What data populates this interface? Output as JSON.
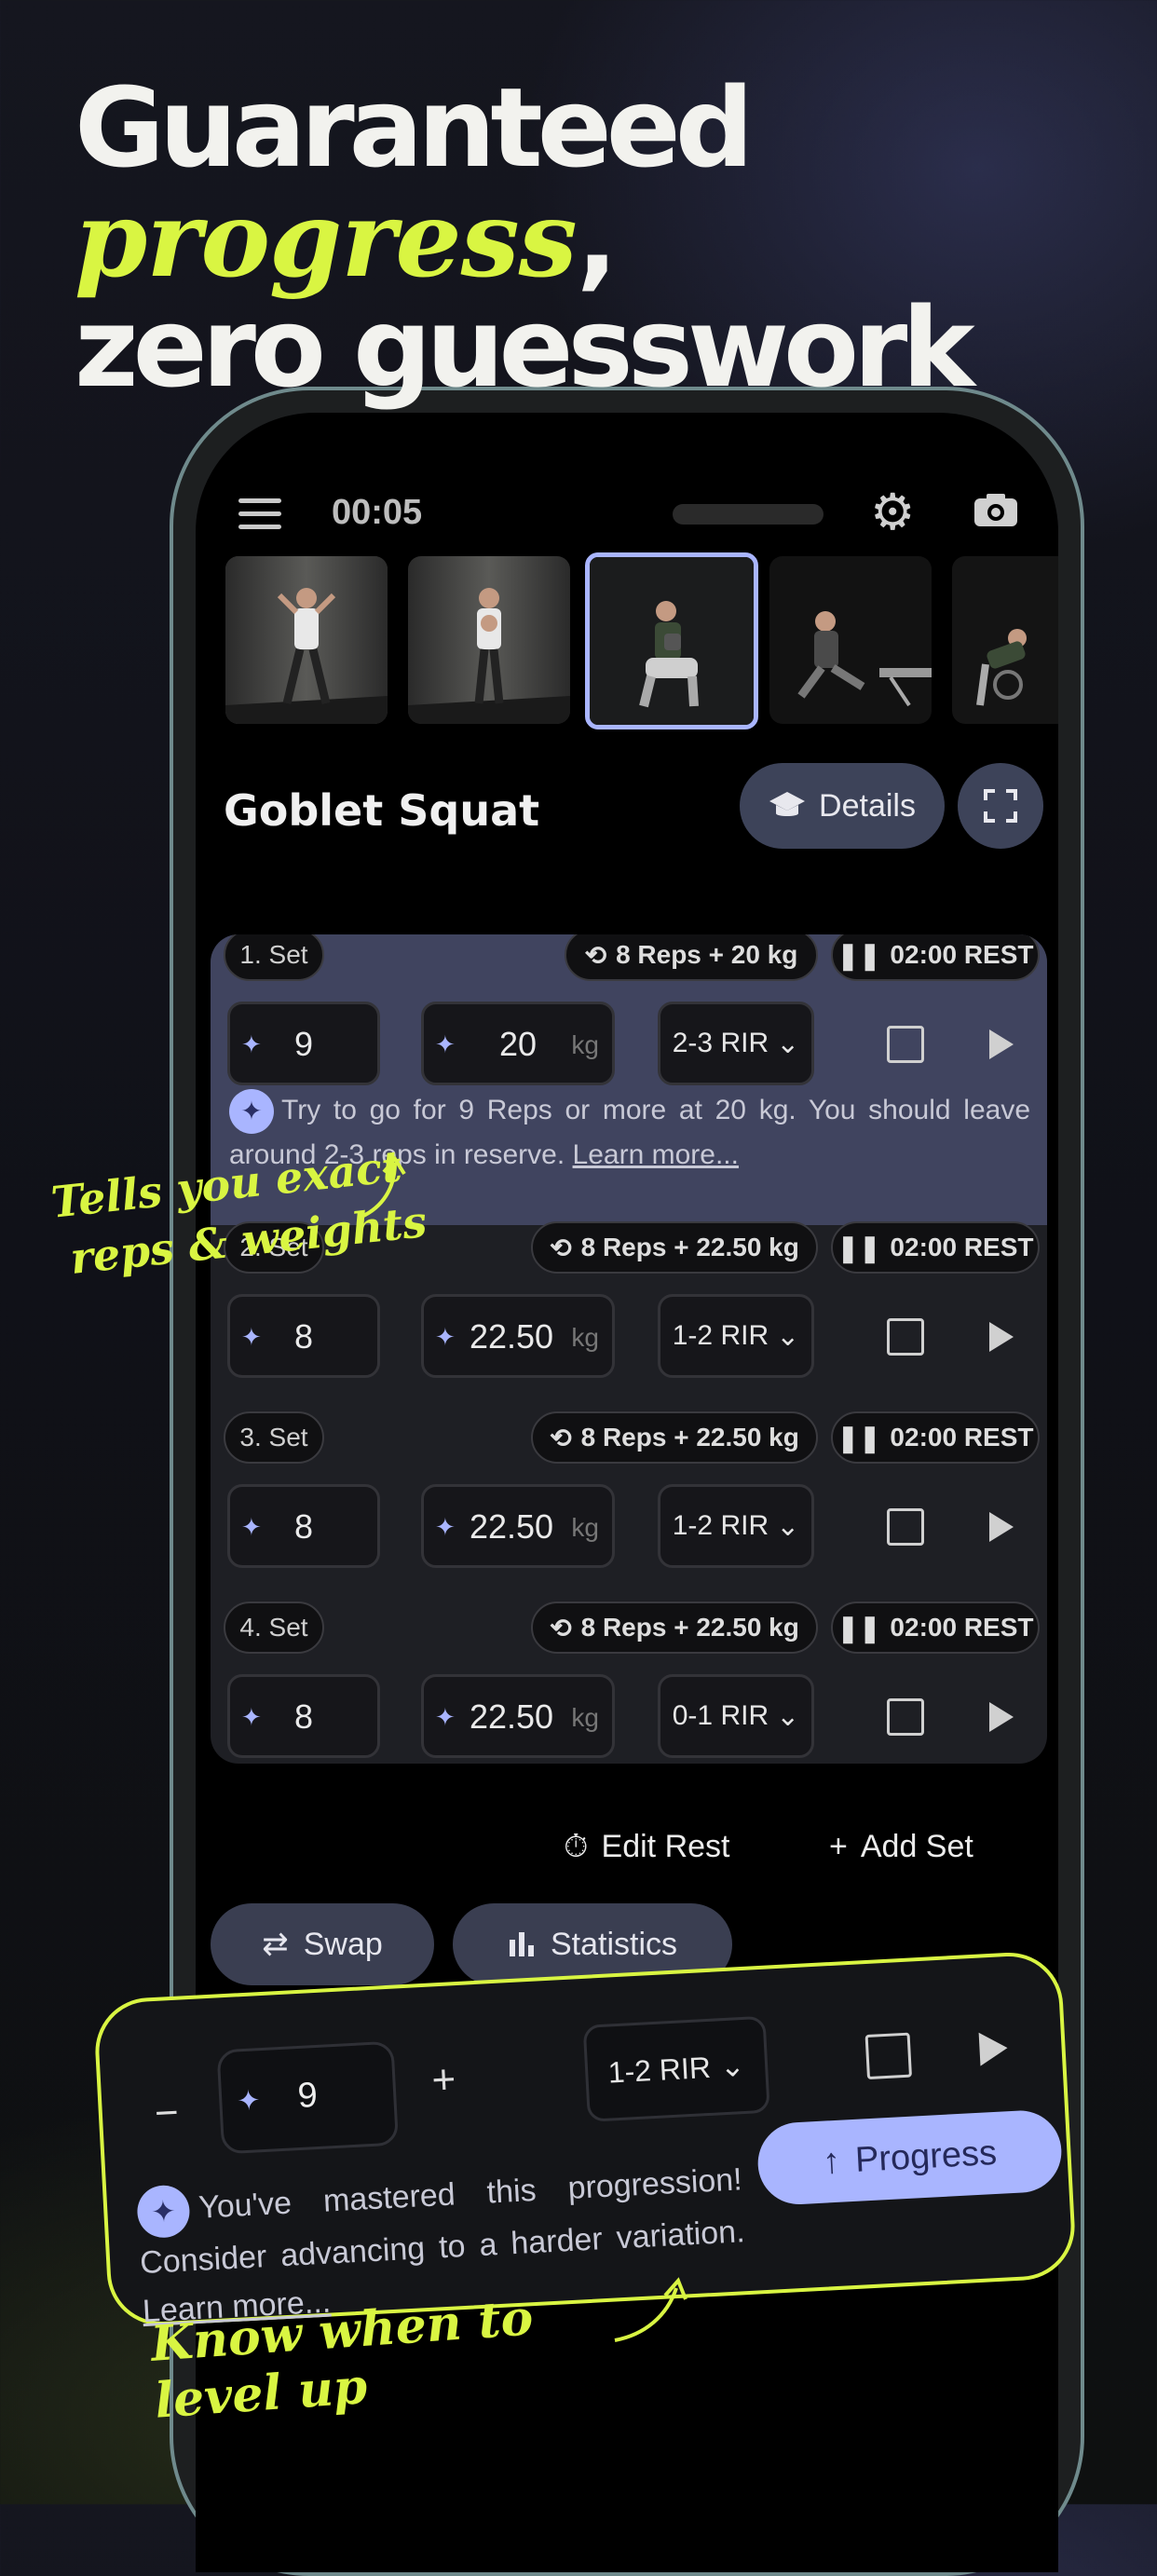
{
  "headline": {
    "line1": "Guaranteed",
    "line2_accent": "progress",
    "line2_comma": ",",
    "line3": "zero guesswork"
  },
  "status": {
    "timer": "00:05",
    "icons": [
      "menu-icon",
      "gear-icon",
      "camera-icon"
    ]
  },
  "exercise": {
    "title": "Goblet Squat",
    "details_label": "Details"
  },
  "sets": [
    {
      "label": "1. Set",
      "target": "8 Reps + 20 kg",
      "rest": "02:00 REST",
      "reps": "9",
      "weight": "20",
      "unit": "kg",
      "rir": "2-3 RIR"
    },
    {
      "label": "2. Set",
      "target": "8 Reps + 22.50 kg",
      "rest": "02:00 REST",
      "reps": "8",
      "weight": "22.50",
      "unit": "kg",
      "rir": "1-2 RIR"
    },
    {
      "label": "3. Set",
      "target": "8 Reps + 22.50 kg",
      "rest": "02:00 REST",
      "reps": "8",
      "weight": "22.50",
      "unit": "kg",
      "rir": "1-2 RIR"
    },
    {
      "label": "4. Set",
      "target": "8 Reps + 22.50 kg",
      "rest": "02:00 REST",
      "reps": "8",
      "weight": "22.50",
      "unit": "kg",
      "rir": "0-1 RIR"
    }
  ],
  "tip": {
    "text": "Try to go for 9 Reps or more at 20 kg. You should leave around 2-3 reps in reserve.",
    "link": "Learn more..."
  },
  "actions": {
    "edit_rest": "Edit Rest",
    "add_set": "Add Set",
    "swap": "Swap",
    "statistics": "Statistics"
  },
  "callout": {
    "minus": "−",
    "reps": "9",
    "plus": "+",
    "rir": "1-2 RIR",
    "text": "You've mastered this progression! Consider advancing to a harder variation.",
    "link": "Learn more...",
    "progress_label": "Progress"
  },
  "annotations": {
    "note1_line1": "Tells you exact",
    "note1_line2": "reps & weights",
    "note2": "Know when to level up"
  },
  "colors": {
    "accent_lime": "#d9f542",
    "accent_periwinkle": "#a9b5ff",
    "highlight_row": "#40445f",
    "phone_frame": "#6f8a8c"
  }
}
